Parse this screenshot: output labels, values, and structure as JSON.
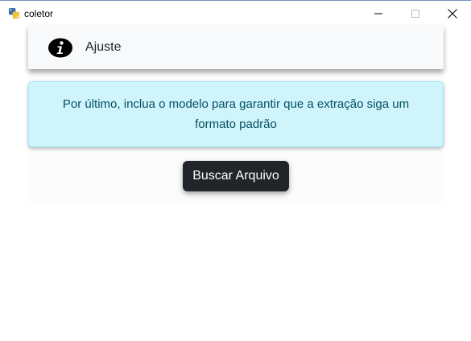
{
  "window": {
    "title": "coletor",
    "app_icon": "python-icon",
    "controls": [
      "minimize-icon",
      "maximize-icon",
      "close-icon"
    ]
  },
  "header": {
    "icon": "info-icon",
    "label": "Ajuste"
  },
  "alert": {
    "message": "Por último, inclua o modelo para garantir que a extração siga um formato padrão"
  },
  "actions": {
    "browse_button_label": "Buscar Arquivo"
  },
  "colors": {
    "alert_bg": "#cff4fc",
    "alert_text": "#055160",
    "button_bg": "#212529",
    "header_bg": "#f8f9fa"
  }
}
